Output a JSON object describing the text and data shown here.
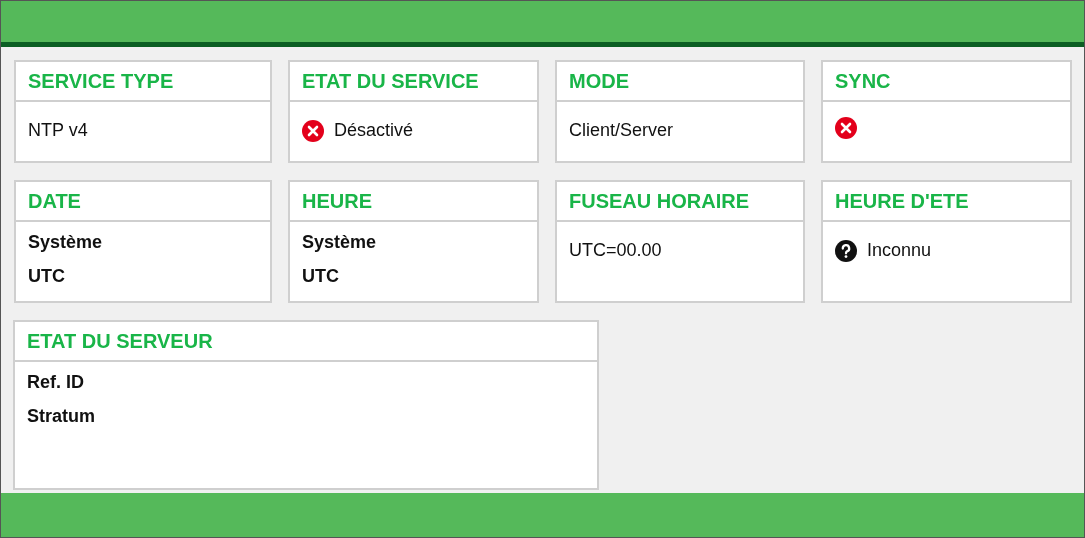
{
  "cards": [
    {
      "title": "SERVICE TYPE",
      "content": {
        "kind": "text",
        "text": "NTP v4"
      }
    },
    {
      "title": "ETAT DU SERVICE",
      "content": {
        "kind": "error",
        "text": "Désactivé"
      }
    },
    {
      "title": "MODE",
      "content": {
        "kind": "text",
        "text": "Client/Server"
      }
    },
    {
      "title": "SYNC",
      "content": {
        "kind": "error"
      }
    },
    {
      "title": "DATE",
      "content": {
        "kind": "fields",
        "lines": [
          "Système",
          "UTC"
        ]
      }
    },
    {
      "title": "HEURE",
      "content": {
        "kind": "fields",
        "lines": [
          "Système",
          "UTC"
        ]
      }
    },
    {
      "title": "FUSEAU HORAIRE",
      "content": {
        "kind": "text",
        "text": "UTC=00.00"
      }
    },
    {
      "title": "HEURE D'ETE",
      "content": {
        "kind": "unknown",
        "text": "Inconnu"
      }
    }
  ],
  "server_card": {
    "title": "ETAT DU SERVEUR",
    "content": {
      "kind": "fields",
      "lines": [
        "Ref. ID",
        "Stratum"
      ]
    }
  }
}
